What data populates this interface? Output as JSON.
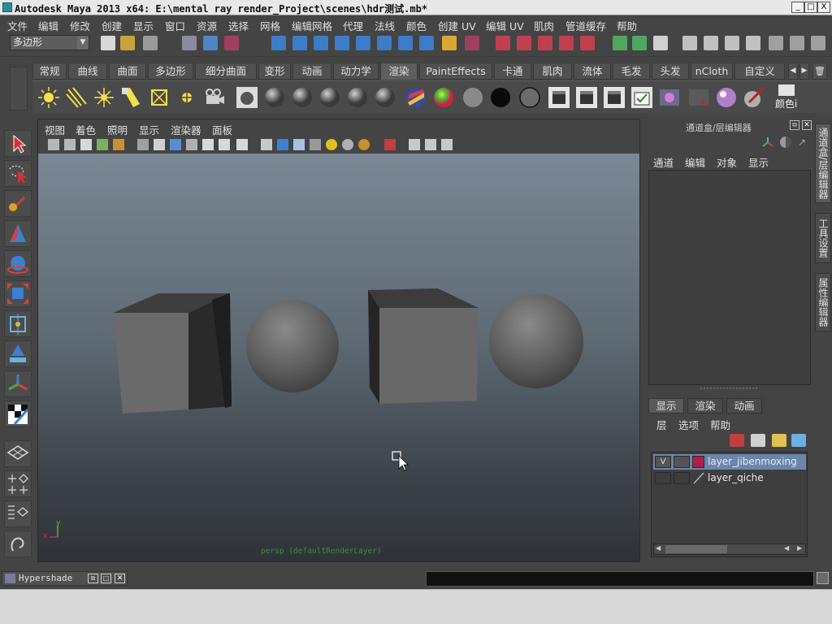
{
  "window": {
    "title": "Autodesk Maya 2013 x64: E:\\mental ray render_Project\\scenes\\hdr测试.mb*",
    "controls": [
      "_",
      "□",
      "X"
    ]
  },
  "menubar": [
    "文件",
    "编辑",
    "修改",
    "创建",
    "显示",
    "窗口",
    "资源",
    "选择",
    "网格",
    "编辑网格",
    "代理",
    "法线",
    "颜色",
    "创建 UV",
    "编辑 UV",
    "肌肉",
    "管道缓存",
    "帮助"
  ],
  "statusline": {
    "menuset": "多边形"
  },
  "shelf": {
    "tabs": [
      "常规",
      "曲线",
      "曲面",
      "多边形",
      "细分曲面",
      "变形",
      "动画",
      "动力学",
      "渲染",
      "PaintEffects",
      "卡通",
      "肌肉",
      "流体",
      "毛发",
      "头发",
      "nCloth",
      "自定义"
    ],
    "active_tab": "渲染",
    "last_icon_label": "颜色i"
  },
  "viewport": {
    "menu": [
      "视图",
      "着色",
      "照明",
      "显示",
      "渲染器",
      "面板"
    ],
    "camera_label": "persp (defaultRenderLayer)",
    "axis": {
      "y": "y",
      "x": "x"
    }
  },
  "channel_box": {
    "header": "通道盒/层编辑器",
    "menu": [
      "通道",
      "编辑",
      "对象",
      "显示"
    ]
  },
  "layer_editor": {
    "tabs": [
      "显示",
      "渲染",
      "动画"
    ],
    "active_tab": "显示",
    "menu": [
      "层",
      "选项",
      "帮助"
    ],
    "layers": [
      {
        "name": "layer_jibenmoxing",
        "visible": "V",
        "color": "#b01e46",
        "selected": true
      },
      {
        "name": "layer_qiche",
        "visible": "",
        "color": "",
        "selected": false
      }
    ]
  },
  "side_tabs": [
    "通道盒/层编辑器",
    "工具设置",
    "属性编辑器"
  ],
  "taskbar": {
    "hypershade_label": "Hypershade"
  },
  "colors": {
    "ui_bg": "#444444",
    "layer_color": "#b01e46",
    "selected_row": "#6a86ad",
    "camera_label": "#3a8a3a"
  }
}
